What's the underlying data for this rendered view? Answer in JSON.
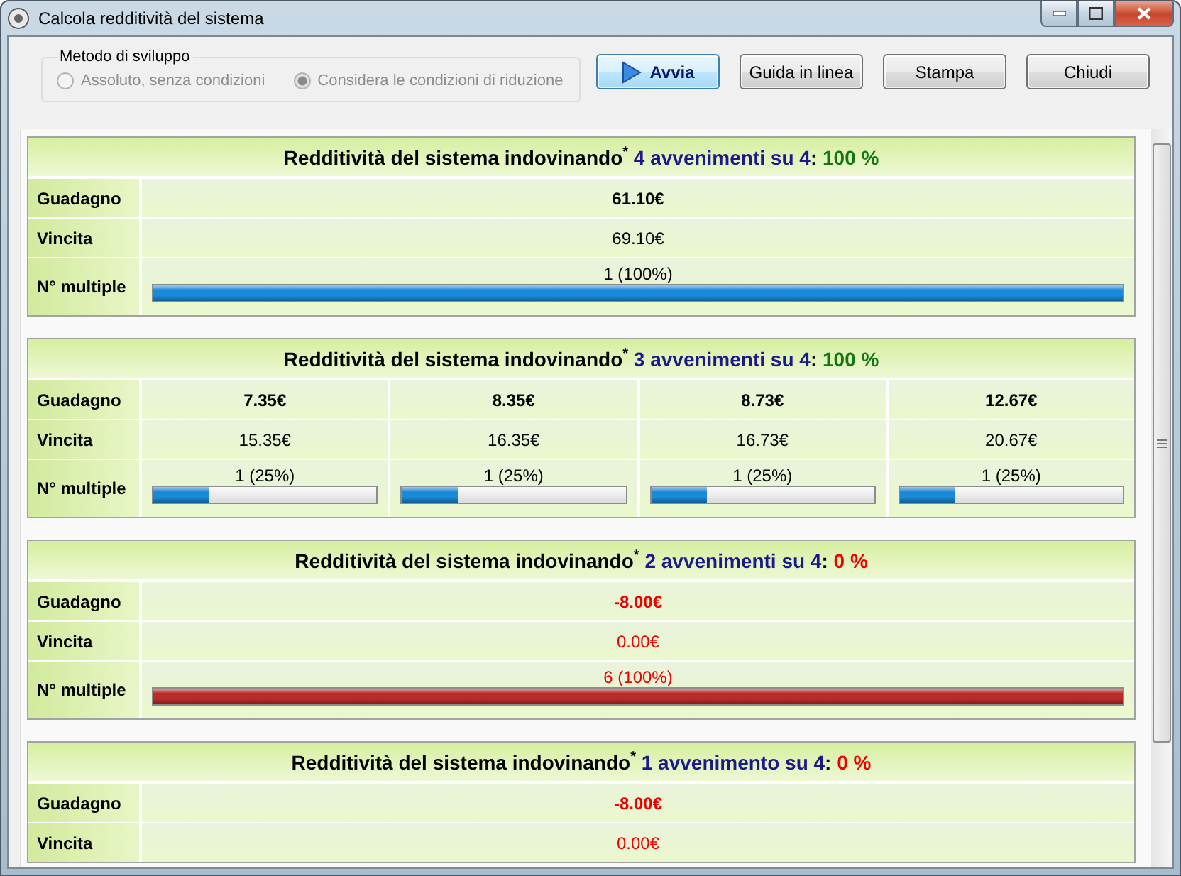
{
  "window": {
    "title": "Calcola redditività del sistema"
  },
  "method": {
    "legend": "Metodo di sviluppo",
    "disabled": true,
    "options": [
      {
        "label": "Assoluto, senza condizioni",
        "selected": false
      },
      {
        "label": "Considera le condizioni di riduzione",
        "selected": true
      }
    ]
  },
  "buttons": [
    {
      "label": "Avvia",
      "kind": "primary"
    },
    {
      "label": "Guida in linea",
      "kind": "plain"
    },
    {
      "label": "Stampa",
      "kind": "plain"
    },
    {
      "label": "Chiudi",
      "kind": "plain"
    }
  ],
  "sections": [
    {
      "title": "Redditività del sistema indovinando$^{*}$",
      "events": "4 avvenimenti su 4",
      "separator": ":",
      "percent": "100 %",
      "color": "#117711",
      "rows": [
        {
          "label": "Guadagno",
          "kind": "gain",
          "cells": [
            {
              "text": "61.10€",
              "color": "#000000"
            }
          ]
        },
        {
          "label": "Vincita",
          "kind": "amount",
          "cells": [
            {
              "text": "69.10€",
              "color": "#000000"
            }
          ]
        },
        {
          "label": "N° multiple",
          "kind": "bar",
          "cells": [
            {
              "text": "1 (100%)",
              "level": 1,
              "color": "#1a8ad8"
            }
          ]
        }
      ]
    },
    {
      "title": "Redditività del sistema indovinando$^{*}$",
      "events": "3 avvenimenti su 4",
      "separator": ":",
      "percent": "100 %",
      "color": "#117711",
      "rows": [
        {
          "label": "Guadagno",
          "kind": "gain",
          "cells": [
            {
              "text": "7.35€",
              "color": "#000000"
            },
            {
              "text": "8.35€",
              "color": "#000000"
            },
            {
              "text": "8.73€",
              "color": "#000000"
            },
            {
              "text": "12.67€",
              "color": "#000000"
            }
          ]
        },
        {
          "label": "Vincita",
          "kind": "amount",
          "cells": [
            {
              "text": "15.35€",
              "color": "#000000"
            },
            {
              "text": "16.35€",
              "color": "#000000"
            },
            {
              "text": "16.73€",
              "color": "#000000"
            },
            {
              "text": "20.67€",
              "color": "#000000"
            }
          ]
        },
        {
          "label": "N° multiple",
          "kind": "bar",
          "cells": [
            {
              "text": "1 (25%)",
              "level": 0.25,
              "color": "#1a8ad8"
            },
            {
              "text": "1 (25%)",
              "level": 0.25,
              "color": "#1a8ad8"
            },
            {
              "text": "1 (25%)",
              "level": 0.25,
              "color": "#1a8ad8"
            },
            {
              "text": "1 (25%)",
              "level": 0.25,
              "color": "#1a8ad8"
            }
          ]
        }
      ]
    },
    {
      "title": "Redditività del sistema indovinando$^{*}$",
      "events": "2 avvenimenti su 4",
      "separator": ":",
      "percent": "0 %",
      "color": "#ee0000",
      "rows": [
        {
          "label": "Guadagno",
          "kind": "gain",
          "cells": [
            {
              "text": "-8.00€",
              "color": "#ee0000"
            }
          ]
        },
        {
          "label": "Vincita",
          "kind": "amount",
          "cells": [
            {
              "text": "0.00€",
              "color": "#ee0000"
            }
          ]
        },
        {
          "label": "N° multiple",
          "kind": "bar",
          "cells": [
            {
              "text": "6 (100%)",
              "level": 1,
              "color": "#b82c2c"
            }
          ]
        }
      ]
    },
    {
      "title": "Redditività del sistema indovinando$^{*}$",
      "events": "1 avvenimento su 4",
      "separator": ":",
      "percent": "0 %",
      "color": "#ee0000",
      "rows": [
        {
          "label": "Guadagno",
          "kind": "gain",
          "cells": [
            {
              "text": "-8.00€",
              "color": "#ee0000"
            }
          ]
        },
        {
          "label": "Vincita",
          "kind": "amount",
          "cells": [
            {
              "text": "0.00€",
              "color": "#ee0000"
            }
          ]
        }
      ]
    }
  ]
}
